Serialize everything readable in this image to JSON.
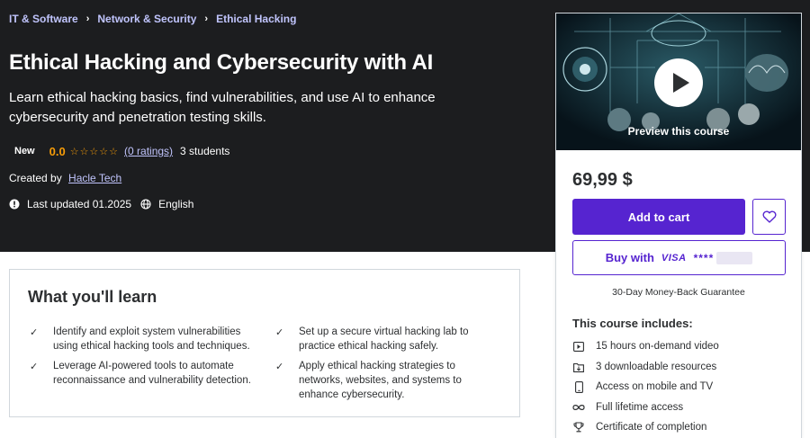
{
  "breadcrumb": [
    "IT & Software",
    "Network & Security",
    "Ethical Hacking"
  ],
  "breadcrumb_sep": "›",
  "course": {
    "title": "Ethical Hacking and Cybersecurity with AI",
    "subtitle": "Learn ethical hacking basics, find vulnerabilities, and use AI to enhance cybersecurity and penetration testing skills.",
    "badge": "New",
    "rating": "0.0",
    "stars": "☆☆☆☆☆",
    "ratings_link": "(0 ratings)",
    "students": "3 students",
    "created_by_label": "Created by",
    "instructor": "Hacle Tech",
    "last_updated": "Last updated 01.2025",
    "language": "English"
  },
  "learn": {
    "title": "What you'll learn",
    "check": "✓",
    "items": [
      "Identify and exploit system vulnerabilities using ethical hacking tools and techniques.",
      "Set up a secure virtual hacking lab to practice ethical hacking safely.",
      "Leverage AI-powered tools to automate reconnaissance and vulnerability detection.",
      "Apply ethical hacking strategies to networks, websites, and systems to enhance cybersecurity."
    ]
  },
  "sidebar": {
    "preview_label": "Preview this course",
    "price": "69,99 $",
    "add_to_cart": "Add to cart",
    "buy_with": "Buy with",
    "card_brand": "VISA",
    "card_mask": "****",
    "guarantee": "30-Day Money-Back Guarantee",
    "includes_title": "This course includes:",
    "includes": [
      {
        "icon": "video-icon",
        "text": "15 hours on-demand video"
      },
      {
        "icon": "folder-icon",
        "text": "3 downloadable resources"
      },
      {
        "icon": "mobile-icon",
        "text": "Access on mobile and TV"
      },
      {
        "icon": "infinity-icon",
        "text": "Full lifetime access"
      },
      {
        "icon": "trophy-icon",
        "text": "Certificate of completion"
      }
    ]
  },
  "colors": {
    "hero_bg": "#1c1d1f",
    "link": "#c0c4fc",
    "star": "#f69c08",
    "primary": "#5624d0"
  }
}
